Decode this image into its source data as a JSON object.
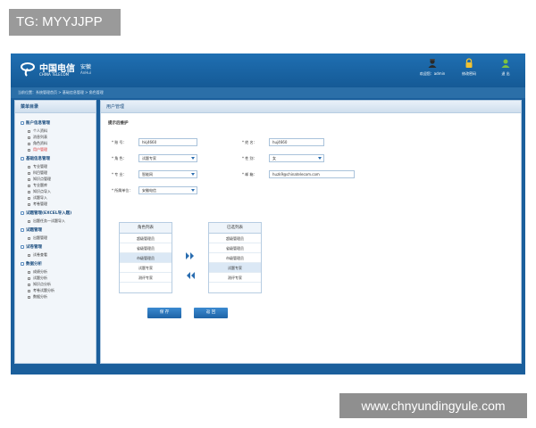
{
  "watermarks": {
    "top": "TG: MYYJJPP",
    "bottom": "www.chnyundingyule.com"
  },
  "header": {
    "logo_cn": "中国电信",
    "logo_en": "CHINA TELECOM",
    "logo_sub": "安徽",
    "logo_sub2": "AnHui",
    "items": [
      {
        "label": "欢迎您：admin",
        "icon": "user-icon"
      },
      {
        "label": "修改密码",
        "icon": "lock-icon"
      },
      {
        "label": "退 出",
        "icon": "logout-icon"
      }
    ]
  },
  "breadcrumb": "当前位置：系统管理首页 > 基础信息管理 > 角色管理",
  "sidebar": {
    "title": "菜单目录",
    "groups": [
      {
        "label": "账户信息管理",
        "items": [
          "个人资料",
          "消息列表",
          "角色资料",
          "用户管理"
        ]
      },
      {
        "label": "基础信息管理",
        "items": [
          "专业管理",
          "科目管理",
          "知识点管理",
          "专业题库",
          "知识点导入",
          "试题导入",
          "考卷管理"
        ]
      },
      {
        "label": "试题管理(EXCEL导入题)",
        "items": [
          "出题任务一试题导入"
        ]
      },
      {
        "label": "试题管理",
        "items": [
          "出题管理"
        ]
      },
      {
        "label": "试卷管理",
        "items": [
          "试卷查看"
        ]
      },
      {
        "label": "数据分析",
        "items": [
          "成绩分析",
          "试题分析",
          "知识点分析",
          "考卷试题分析",
          "数据分析"
        ]
      }
    ],
    "active_item": "用户管理"
  },
  "main": {
    "title": "用户管理",
    "section_title": "提示后维护",
    "form": {
      "account_label": "* 账    号：",
      "account_value": "hkj4660",
      "name_label": "* 姓    名：",
      "name_value": "huj4660",
      "role_label": "* 角    色：",
      "role_value": "试题专家",
      "gender_label": "* 性    别：",
      "gender_value": "女",
      "major_label": "* 专    业：",
      "major_value": "智能网",
      "email_label": "* 邮    箱：",
      "email_value": "huzk9@chinatelecom.com",
      "org_label": "* 所属单位：",
      "org_value": "安徽电信"
    },
    "transfer": {
      "left_title": "角色列表",
      "right_title": "已选列表",
      "left_items": [
        "超级管理员",
        "省级管理员",
        "市级管理员",
        "试题专家",
        "测评专家"
      ],
      "right_items": [
        "超级管理员",
        "省级管理员",
        "市级管理员",
        "试题专家",
        "测评专家"
      ],
      "left_highlight": 2,
      "right_highlight": 3,
      "add_icon": "double-right-arrow-icon",
      "remove_icon": "double-left-arrow-icon"
    },
    "buttons": {
      "save": "保 存",
      "back": "返 回"
    }
  },
  "colors": {
    "accent": "#1e63a6",
    "header": "#1b5f9c",
    "panel_border": "#b7cde2"
  }
}
